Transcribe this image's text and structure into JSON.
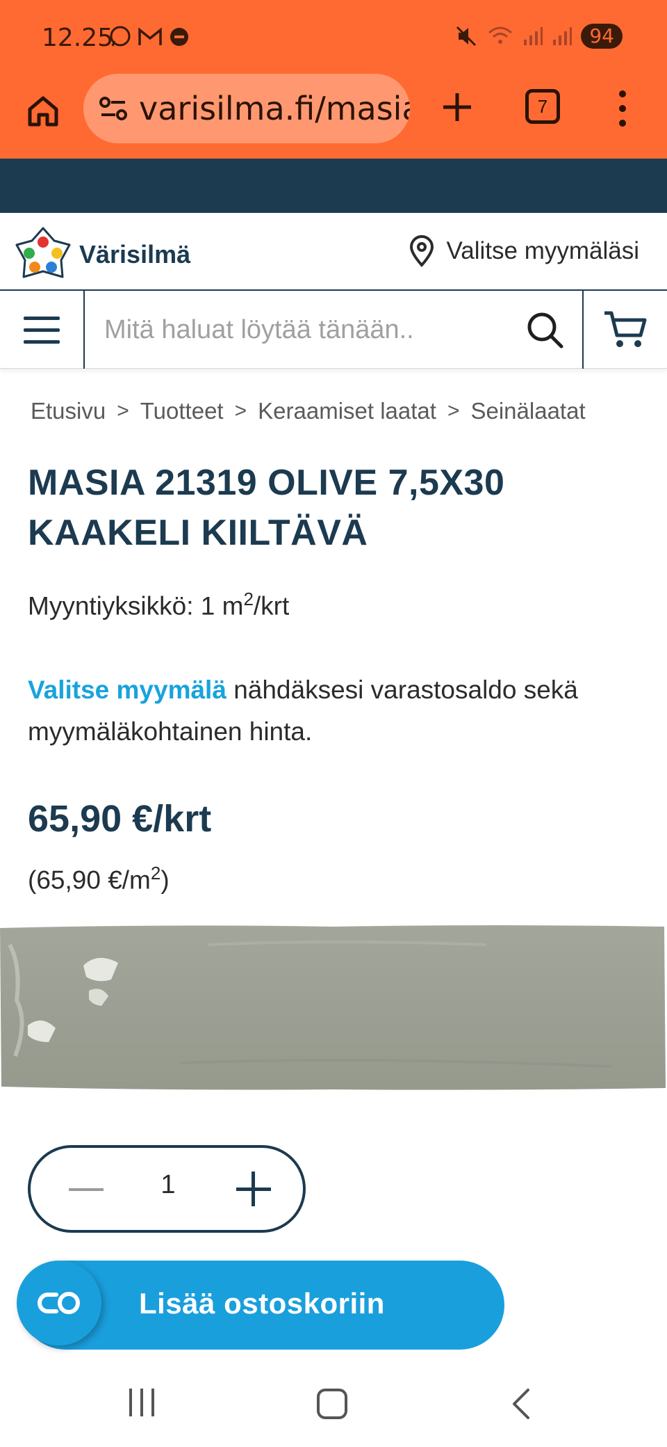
{
  "status_bar": {
    "time": "12.25",
    "battery": "94",
    "app_icons": [
      "whatsapp-icon",
      "gmail-icon",
      "record-icon"
    ],
    "system_icons": [
      "mute-icon",
      "wifi-icon",
      "signal-icon",
      "signal-icon"
    ]
  },
  "browser": {
    "url": "varisilma.fi/masia",
    "tab_count": "7"
  },
  "site": {
    "logo_text": "Värisilmä",
    "store_picker_label": "Valitse myymäläsi",
    "search_placeholder": "Mitä haluat löytää tänään.."
  },
  "breadcrumb": [
    "Etusivu",
    "Tuotteet",
    "Keraamiset laatat",
    "Seinälaatat"
  ],
  "product": {
    "title": "MASIA 21319 OLIVE 7,5X30 KAAKELI KIILTÄVÄ",
    "sales_unit_prefix": "Myyntiyksikkö: 1 m",
    "sales_unit_sup": "2",
    "sales_unit_suffix": "/krt",
    "store_link": "Valitse myymälä",
    "store_note": " nähdäksesi varastosaldo sekä myymäläkohtainen hinta.",
    "price": "65,90 €/krt",
    "unit_price_prefix": "(65,90 €/m",
    "unit_price_sup": "2",
    "unit_price_suffix": ")",
    "quantity": "1",
    "add_to_cart_label": "Lisää ostoskoriin"
  },
  "colors": {
    "browser_bar": "#ff6a32",
    "brand_dark": "#1c3a50",
    "accent_blue": "#1a9fdd",
    "tile_color": "#9da195"
  }
}
